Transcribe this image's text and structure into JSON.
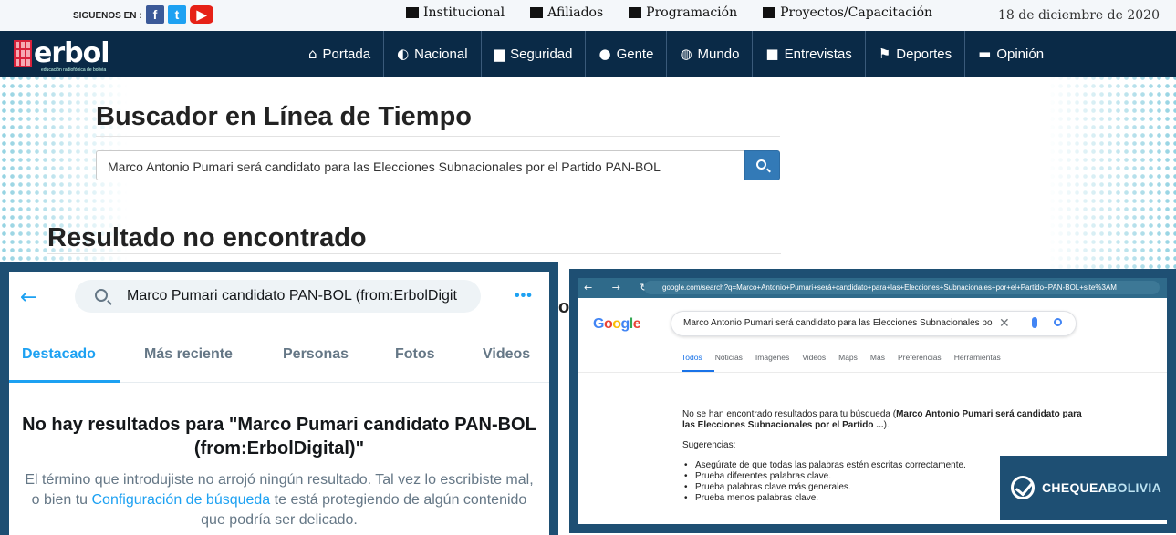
{
  "topbar": {
    "follow_label": "SIGUENOS EN :",
    "social": [
      {
        "name": "facebook-icon",
        "glyph": "f"
      },
      {
        "name": "twitter-icon",
        "glyph": "t"
      },
      {
        "name": "youtube-icon",
        "glyph": "▶"
      }
    ],
    "links": [
      {
        "label": "Institucional",
        "icon": "building-icon"
      },
      {
        "label": "Afiliados",
        "icon": "folder-icon"
      },
      {
        "label": "Programación",
        "icon": "headphones-icon"
      },
      {
        "label": "Proyectos/Capacitación",
        "icon": "graduation-cap-icon"
      }
    ],
    "date": "18 de diciembre de 2020"
  },
  "nav": {
    "logo_text": "erbol",
    "logo_sub": "educación radiofónica de bolivia",
    "items": [
      {
        "label": "Portada",
        "icon": "home-icon",
        "glyph": "⌂"
      },
      {
        "label": "Nacional",
        "icon": "half-circle-icon",
        "glyph": "◐"
      },
      {
        "label": "Seguridad",
        "icon": "lock-icon",
        "glyph": "▆"
      },
      {
        "label": "Gente",
        "icon": "user-icon",
        "glyph": "●"
      },
      {
        "label": "Mundo",
        "icon": "globe-icon",
        "glyph": "◍"
      },
      {
        "label": "Entrevistas",
        "icon": "video-camera-icon",
        "glyph": "■"
      },
      {
        "label": "Deportes",
        "icon": "flag-icon",
        "glyph": "⚑"
      },
      {
        "label": "Opinión",
        "icon": "comment-icon",
        "glyph": "▬"
      }
    ],
    "colors": {
      "nav_bg": "#0a2a47",
      "accent_red": "#d8213a"
    }
  },
  "search": {
    "heading": "Buscador en Línea de Tiempo",
    "query": "Marco Antonio Pumari será candidato para las Elecciones Subnacionales por el Partido PAN-BOL",
    "button_icon": "search-icon",
    "button_color": "#337ab7"
  },
  "result": {
    "heading": "Resultado no encontrado"
  },
  "twitter_capture": {
    "back_glyph": "←",
    "query": "Marco Pumari candidato PAN-BOL  (from:ErbolDigit",
    "more_glyph": "•••",
    "tabs": [
      "Destacado",
      "Más reciente",
      "Personas",
      "Fotos",
      "Videos"
    ],
    "active_tab": "Destacado",
    "no_results_line1": "No hay resultados para \"Marco Pumari candidato PAN-BOL",
    "no_results_line2": "(from:ErbolDigital)\"",
    "desc_line1": "El término que introdujiste no arrojó ningún resultado. Tal vez lo escribiste mal,",
    "desc_line2_pre": "o bien tu ",
    "desc_line2_link": "Configuración de búsqueda",
    "desc_line2_post": " te está protegiendo de algún contenido",
    "desc_line3": "que podría ser delicado."
  },
  "stray_char": "o",
  "google_capture": {
    "nav_glyphs": "← → ↻",
    "url": "google.com/search?q=Marco+Antonio+Pumari+será+candidato+para+las+Elecciones+Subnacionales+por+el+Partido+PAN-BOL+site%3AM",
    "logo_letters": [
      "G",
      "o",
      "o",
      "g",
      "l",
      "e"
    ],
    "query": "Marco Antonio Pumari será candidato para las Elecciones Subnacionales po",
    "clear_glyph": "✕",
    "tabs": [
      "Todos",
      "Noticias",
      "Imágenes",
      "Videos",
      "Maps",
      "Más",
      "Preferencias",
      "Herramientas"
    ],
    "active_tab": "Todos",
    "no_results_pre": "No se han encontrado resultados para tu búsqueda (",
    "no_results_bold": "Marco Antonio Pumari será candidato para las Elecciones Subnacionales por el Partido ...",
    "no_results_post": ").",
    "suggestions_label": "Sugerencias:",
    "suggestions": [
      "Asegúrate de que todas las palabras estén escritas correctamente.",
      "Prueba diferentes palabras clave.",
      "Prueba palabras clave más generales.",
      "Prueba menos palabras clave."
    ]
  },
  "badge": {
    "text_strong": "CHEQUEA",
    "text_light": "BOLIVIA"
  }
}
